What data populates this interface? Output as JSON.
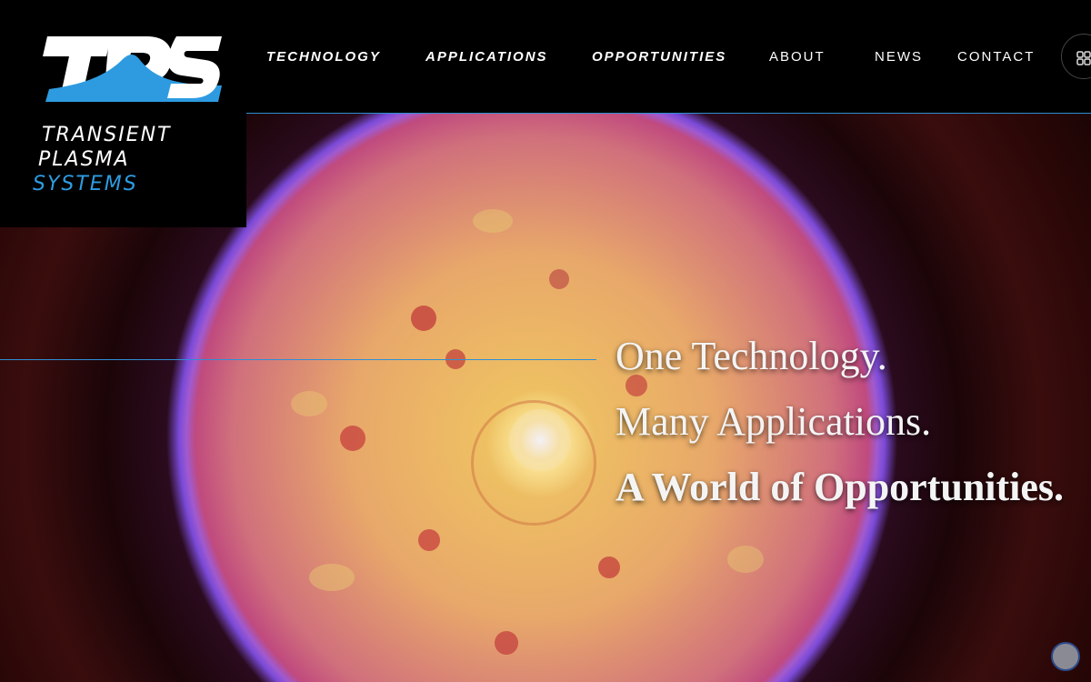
{
  "brand": {
    "mark": "TPS",
    "line1": "TRANSIENT",
    "line2": "PLASMA",
    "line3": "SYSTEMS",
    "colors": {
      "mark_white": "#ffffff",
      "accent_blue": "#2e9be0"
    }
  },
  "nav": {
    "items": [
      {
        "label": "TECHNOLOGY"
      },
      {
        "label": "APPLICATIONS"
      },
      {
        "label": "OPPORTUNITIES"
      },
      {
        "label": "ABOUT"
      },
      {
        "label": "NEWS"
      },
      {
        "label": "CONTACT"
      }
    ],
    "menu_icon": "grid-menu-icon"
  },
  "hero": {
    "line1": "One Technology.",
    "line2": "Many Applications.",
    "line3": "A World of Opportunities.",
    "accent_line_color": "#2e8fd6"
  },
  "widgets": {
    "chat_icon": "chat-bubble-icon"
  }
}
